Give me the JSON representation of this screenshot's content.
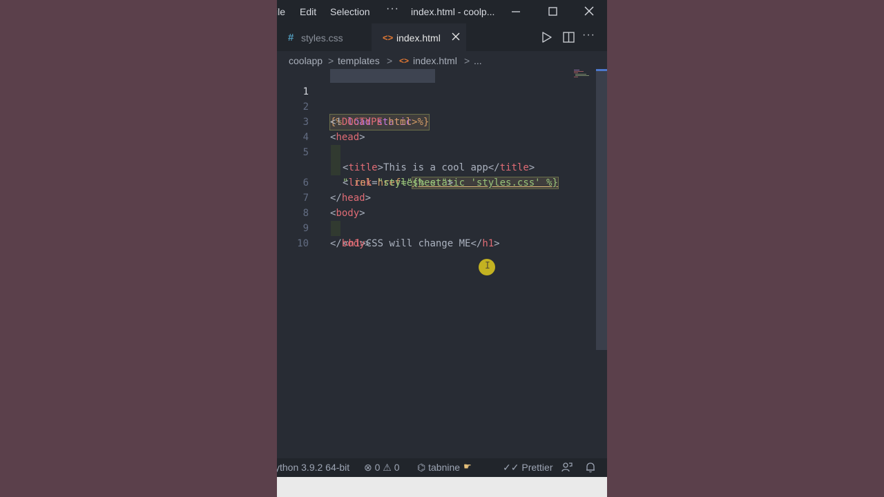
{
  "titlebar": {
    "menu_file": "ile",
    "menu_edit": "Edit",
    "menu_selection": "Selection",
    "menu_more": "···",
    "window_title": "index.html - coolp..."
  },
  "tabs": [
    {
      "label": "styles.css",
      "icon": "css-hash-icon",
      "icon_glyph": "#",
      "active": false
    },
    {
      "label": "index.html",
      "icon": "html-angle-icon",
      "icon_glyph": "<>",
      "active": true
    }
  ],
  "toolbar": {
    "more": "···"
  },
  "breadcrumb": {
    "items": [
      "coolapp",
      "templates",
      "index.html",
      "..."
    ],
    "separator": ">",
    "file_icon_glyph": "<>"
  },
  "editor": {
    "line_numbers": [
      "1",
      "2",
      "3",
      "4",
      "5",
      "",
      "6",
      "7",
      "8",
      "9",
      "10"
    ],
    "active_line": "1",
    "lines": {
      "l1": {
        "open": "{%",
        "kw1": " load",
        "kw2": " static",
        "close": " %}"
      },
      "l2": {
        "a": "<!",
        "doctype": "DOCTYPE",
        "b": " html>"
      },
      "l3": {
        "a": "<",
        "tag": "head",
        "b": ">"
      },
      "l4": {
        "a": "<",
        "tag": "title",
        "b": ">",
        "text": "This is a cool app",
        "c": "</",
        "tag2": "title",
        "d": ">"
      },
      "l5": {
        "a": "<",
        "tag": "link",
        "attr": " href",
        "eq": "=\"",
        "tmpl": "{% static 'styles.css' %}"
      },
      "l5b": {
        "q": "\"",
        "attr": " rel",
        "eq": "=",
        "str": "\"stylesheet\"",
        "end": ">"
      },
      "l6": {
        "a": "</",
        "tag": "head",
        "b": ">"
      },
      "l7": {
        "a": "<",
        "tag": "body",
        "b": ">"
      },
      "l8": {
        "a": "<",
        "tag": "h1",
        "b": ">",
        "text": "CSS will change ME",
        "c": "</",
        "tag2": "h1",
        "d": ">"
      },
      "l9": {
        "a": "</",
        "tag": "body",
        "b": ">"
      }
    }
  },
  "statusbar": {
    "python": "ython 3.9.2 64-bit",
    "errors": "⊗ 0 ⚠ 0",
    "tabnine": "⌬ tabnine",
    "prettier": "✓✓ Prettier"
  },
  "colors": {
    "background": "#5b404b",
    "editor_bg": "#282c34",
    "chrome_bg": "#21252b",
    "tag": "#e06c75",
    "attribute": "#d19a66",
    "string": "#98c379",
    "keyword": "#c678dd",
    "cursor_highlight": "#d4c11f"
  }
}
